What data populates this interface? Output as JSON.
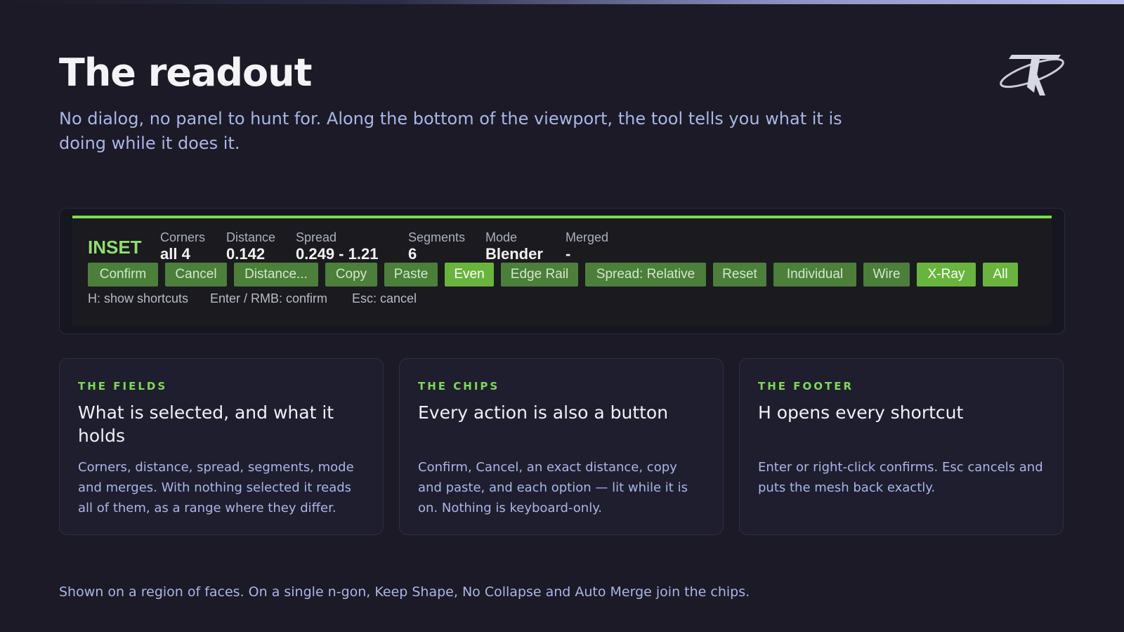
{
  "page": {
    "title": "The readout",
    "subtitle": "No dialog, no panel to hunt for. Along the bottom of the viewport, the tool tells you what it is doing while it does it.",
    "bottom_note": "Shown on a region of faces. On a single n-gon, Keep Shape, No Collapse and Auto Merge join the chips."
  },
  "readout": {
    "mode": "INSET",
    "fields": [
      {
        "label": "Corners",
        "value": "all 4"
      },
      {
        "label": "Distance",
        "value": "0.142"
      },
      {
        "label": "Spread",
        "value": "0.249 - 1.21"
      },
      {
        "label": "Segments",
        "value": "6"
      },
      {
        "label": "Mode",
        "value": "Blender"
      },
      {
        "label": "Merged",
        "value": "-"
      }
    ],
    "chips": [
      {
        "label": "Confirm",
        "on": false
      },
      {
        "label": "Cancel",
        "on": false
      },
      {
        "label": "Distance...",
        "on": false
      },
      {
        "label": "Copy",
        "on": false
      },
      {
        "label": "Paste",
        "on": false
      },
      {
        "label": "Even",
        "on": true
      },
      {
        "label": "Edge Rail",
        "on": false
      },
      {
        "label": "Spread: Relative",
        "on": false
      },
      {
        "label": "Reset",
        "on": false
      },
      {
        "label": "Individual",
        "on": false
      },
      {
        "label": "Wire",
        "on": false
      },
      {
        "label": "X-Ray",
        "on": true
      },
      {
        "label": "All",
        "on": true
      }
    ],
    "hints": [
      "H: show shortcuts",
      "Enter / RMB: confirm",
      "Esc: cancel"
    ]
  },
  "cards": [
    {
      "kicker": "THE FIELDS",
      "title": "What is selected, and what it holds",
      "body": "Corners, distance, spread, segments, mode and merges. With nothing selected it reads all of them, as a range where they differ."
    },
    {
      "kicker": "THE CHIPS",
      "title": "Every action is also a button",
      "body": "Confirm, Cancel, an exact distance, copy and paste, and each option — lit while it is on. Nothing is keyboard-only."
    },
    {
      "kicker": "THE FOOTER",
      "title": "H opens every shortcut",
      "body": "Enter or right-click confirms. Esc cancels and puts the mesh back exactly."
    }
  ],
  "colors": {
    "accent": "#7ed957",
    "chip": "#4b7f3a",
    "chip_on": "#68b43d",
    "background": "#1b1a26"
  }
}
